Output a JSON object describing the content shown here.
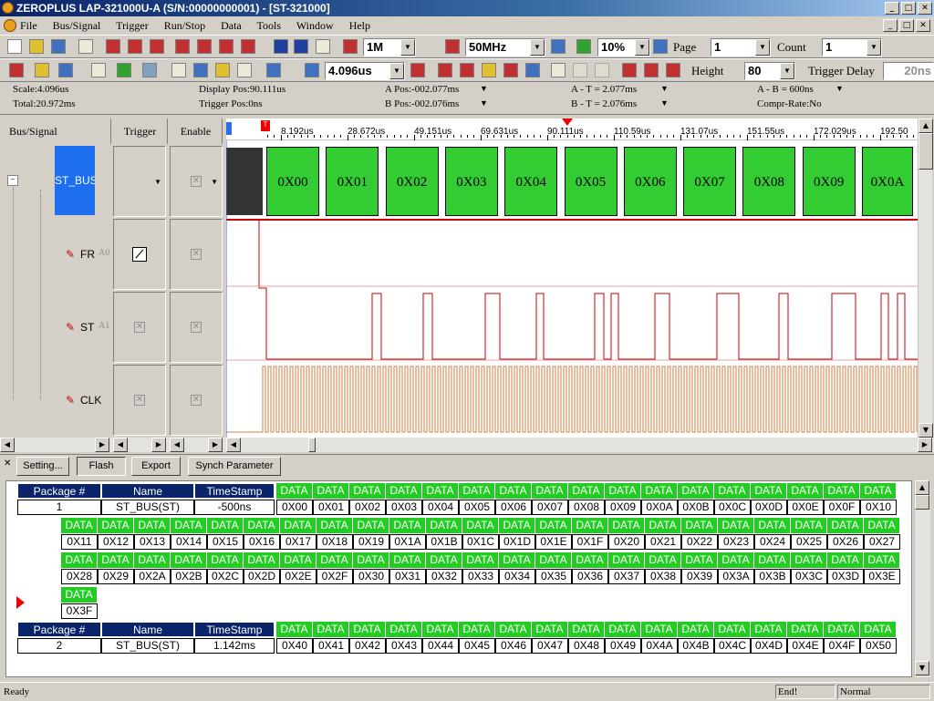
{
  "window": {
    "title": "ZEROPLUS LAP-321000U-A (S/N:00000000001) - [ST-321000]"
  },
  "menu": [
    "File",
    "Bus/Signal",
    "Trigger",
    "Run/Stop",
    "Data",
    "Tools",
    "Window",
    "Help"
  ],
  "toolbar1": {
    "memory": "1M",
    "frequency": "50MHz",
    "trigger_pos": "10%",
    "page_label": "Page",
    "page_value": "1",
    "count_label": "Count",
    "count_value": "1"
  },
  "toolbar2": {
    "scale_value": "4.096us",
    "bar_labels": [
      "Bar",
      "Bar",
      "Bar",
      "Bar",
      "Bar"
    ],
    "height_label": "Height",
    "height_value": "80",
    "trigger_delay_label": "Trigger Delay",
    "trigger_delay_value": "20ns"
  },
  "info": {
    "scale": "Scale:4.096us",
    "total": "Total:20.972ms",
    "display_pos": "Display Pos:90.111us",
    "trigger_pos": "Trigger Pos:0ns",
    "a_pos": "A Pos:-002.077ms",
    "b_pos": "B Pos:-002.076ms",
    "a_t": "A - T = 2.077ms",
    "b_t": "B - T = 2.076ms",
    "a_b": "A - B = 600ns",
    "compr": "Compr-Rate:No"
  },
  "columns": {
    "bus_signal": "Bus/Signal",
    "trigger": "Trigger",
    "enable": "Enable"
  },
  "signals": [
    {
      "name": "ST_BUS(ST",
      "type": "bus"
    },
    {
      "name": "FR",
      "suffix": "A0"
    },
    {
      "name": "ST",
      "suffix": "A1"
    },
    {
      "name": "CLK",
      "suffix": ""
    }
  ],
  "ruler": {
    "ticks": [
      "8.192us",
      "28.672us",
      "49.151us",
      "69.631us",
      "90.111us",
      "110.59us",
      "131.07us",
      "151.55us",
      "172.029us",
      "192.50"
    ]
  },
  "bus_packets": [
    "0X00",
    "0X01",
    "0X02",
    "0X03",
    "0X04",
    "0X05",
    "0X06",
    "0X07",
    "0X08",
    "0X09",
    "0X0A"
  ],
  "buttons": {
    "setting": "Setting...",
    "flash": "Flash",
    "export": "Export",
    "synch": "Synch Parameter"
  },
  "packages": [
    {
      "headers": {
        "package": "Package #",
        "name": "Name",
        "timestamp": "TimeStamp"
      },
      "number": "1",
      "name": "ST_BUS(ST)",
      "timestamp": "-500ns",
      "rows": [
        [
          "0X00",
          "0X01",
          "0X02",
          "0X03",
          "0X04",
          "0X05",
          "0X06",
          "0X07",
          "0X08",
          "0X09",
          "0X0A",
          "0X0B",
          "0X0C",
          "0X0D",
          "0X0E",
          "0X0F",
          "0X10"
        ],
        [
          "0X11",
          "0X12",
          "0X13",
          "0X14",
          "0X15",
          "0X16",
          "0X17",
          "0X18",
          "0X19",
          "0X1A",
          "0X1B",
          "0X1C",
          "0X1D",
          "0X1E",
          "0X1F",
          "0X20",
          "0X21",
          "0X22",
          "0X23",
          "0X24",
          "0X25",
          "0X26",
          "0X27"
        ],
        [
          "0X28",
          "0X29",
          "0X2A",
          "0X2B",
          "0X2C",
          "0X2D",
          "0X2E",
          "0X2F",
          "0X30",
          "0X31",
          "0X32",
          "0X33",
          "0X34",
          "0X35",
          "0X36",
          "0X37",
          "0X38",
          "0X39",
          "0X3A",
          "0X3B",
          "0X3C",
          "0X3D",
          "0X3E"
        ],
        [
          "0X3F"
        ]
      ]
    },
    {
      "headers": {
        "package": "Package #",
        "name": "Name",
        "timestamp": "TimeStamp"
      },
      "number": "2",
      "name": "ST_BUS(ST)",
      "timestamp": "1.142ms",
      "rows": [
        [
          "0X40",
          "0X41",
          "0X42",
          "0X43",
          "0X44",
          "0X45",
          "0X46",
          "0X47",
          "0X48",
          "0X49",
          "0X4A",
          "0X4B",
          "0X4C",
          "0X4D",
          "0X4E",
          "0X4F",
          "0X50"
        ]
      ]
    }
  ],
  "data_header": "DATA",
  "status": {
    "ready": "Ready",
    "end": "End!",
    "mode": "Normal"
  }
}
